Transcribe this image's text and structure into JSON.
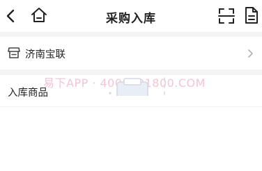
{
  "header": {
    "title": "采购入库",
    "back_icon": "chevron-left-icon",
    "home_icon": "home-icon",
    "scan_icon": "scan-icon",
    "doc_icon": "document-icon"
  },
  "supplier": {
    "label": "济南宝联",
    "icon": "store-icon"
  },
  "goods": {
    "heading": "入库商品",
    "watermark": "易下APP · 4008891800.COM"
  },
  "colors": {
    "background": "#f4f4f6",
    "watermark": "#f5c4d3"
  }
}
